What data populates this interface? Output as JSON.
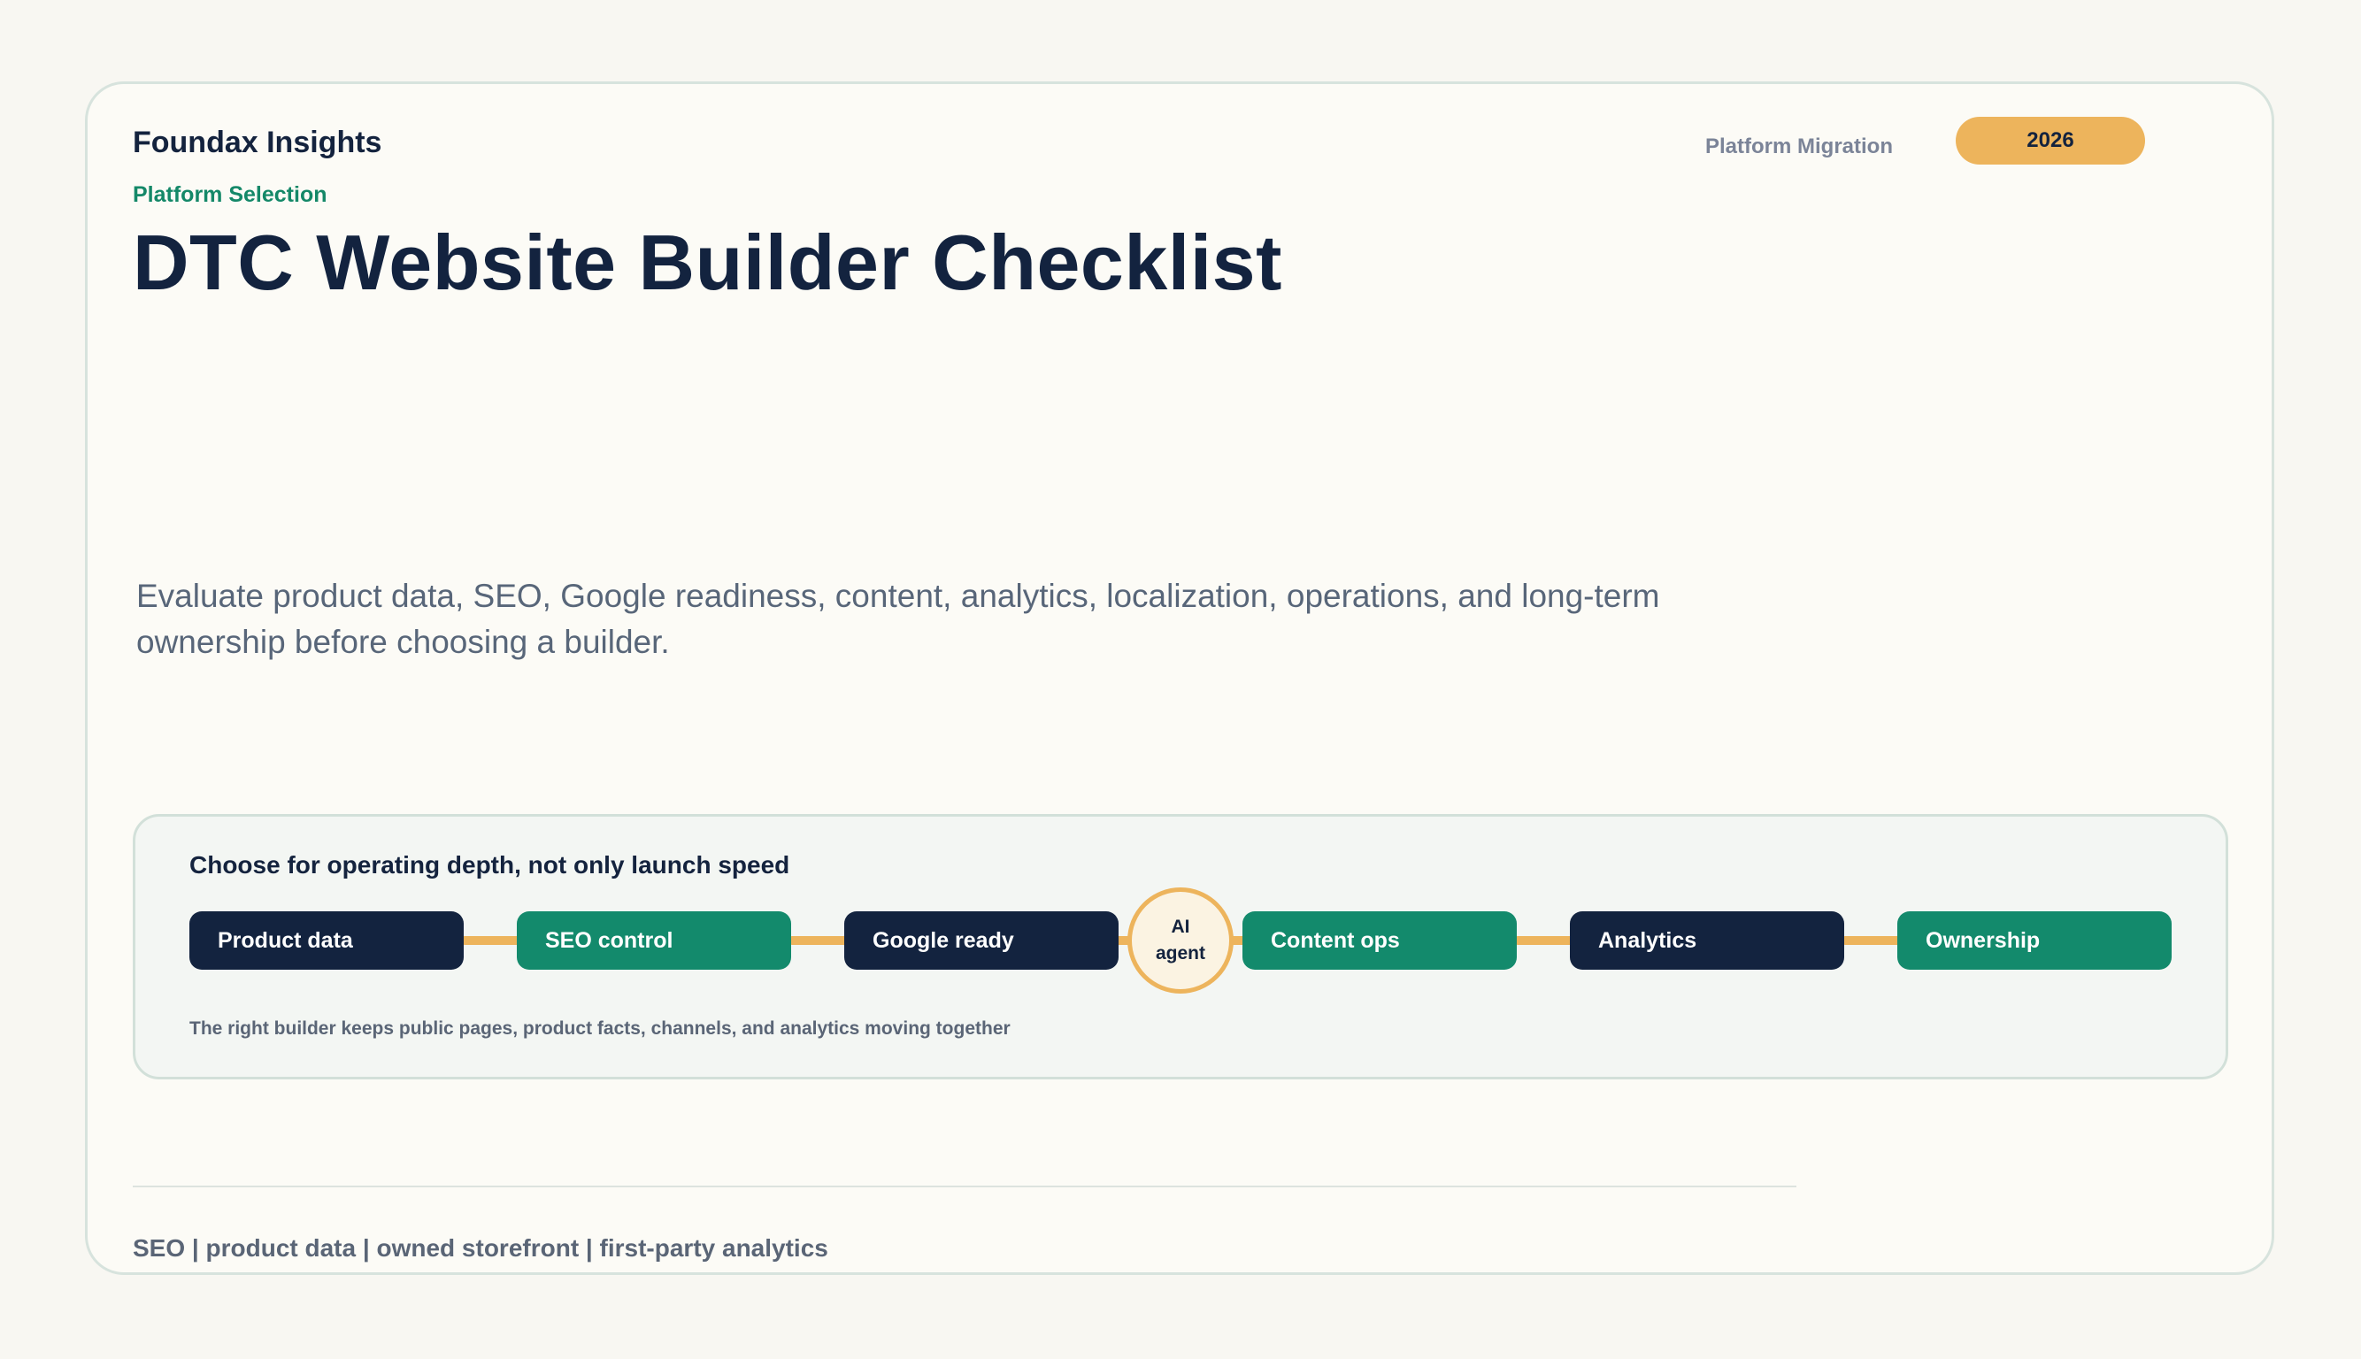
{
  "header": {
    "brand": "Foundax Insights",
    "kicker": "Platform Selection",
    "title": "DTC Website Builder Checklist",
    "meta_label": "Platform Migration",
    "year": "2026"
  },
  "description": "Evaluate product data, SEO, Google readiness, content, analytics, localization, operations, and long-term ownership before choosing a builder.",
  "flow": {
    "title": "Choose for operating depth, not only launch speed",
    "steps": [
      {
        "label": "Product data",
        "style": "navy"
      },
      {
        "label": "SEO control",
        "style": "green"
      },
      {
        "label": "Google ready",
        "style": "navy"
      },
      {
        "label": "Content ops",
        "style": "green"
      },
      {
        "label": "Analytics",
        "style": "navy"
      },
      {
        "label": "Ownership",
        "style": "green"
      }
    ],
    "hub": {
      "line1": "AI",
      "line2": "agent"
    },
    "note": "The right builder keeps public pages, product facts, channels, and analytics moving together"
  },
  "footer": {
    "tags": "SEO | product data | owned storefront | first-party analytics"
  },
  "colors": {
    "navy": "#13233f",
    "green": "#138a6c",
    "accent": "#edb45c",
    "background": "#f8f7f2"
  }
}
